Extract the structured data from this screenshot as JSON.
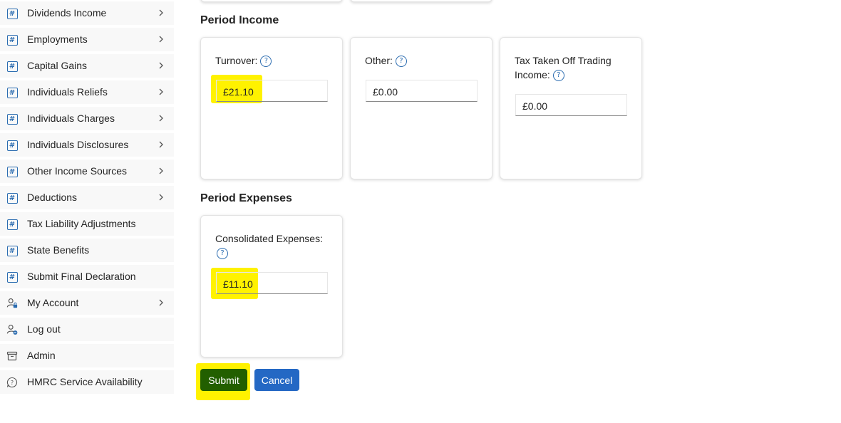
{
  "sidebar": {
    "items": [
      {
        "label": "Dividends Income",
        "icon": "hash-icon",
        "chevron": true
      },
      {
        "label": "Employments",
        "icon": "hash-icon",
        "chevron": true
      },
      {
        "label": "Capital Gains",
        "icon": "hash-icon",
        "chevron": true
      },
      {
        "label": "Individuals Reliefs",
        "icon": "hash-icon",
        "chevron": true
      },
      {
        "label": "Individuals Charges",
        "icon": "hash-icon",
        "chevron": true
      },
      {
        "label": "Individuals Disclosures",
        "icon": "hash-icon",
        "chevron": true
      },
      {
        "label": "Other Income Sources",
        "icon": "hash-icon",
        "chevron": true
      },
      {
        "label": "Deductions",
        "icon": "hash-icon",
        "chevron": true
      },
      {
        "label": "Tax Liability Adjustments",
        "icon": "hash-icon",
        "chevron": false
      },
      {
        "label": "State Benefits",
        "icon": "hash-icon",
        "chevron": false
      },
      {
        "label": "Submit Final Declaration",
        "icon": "hash-icon",
        "chevron": false
      },
      {
        "label": "My Account",
        "icon": "person-lock-icon",
        "chevron": true
      },
      {
        "label": "Log out",
        "icon": "person-minus-icon",
        "chevron": false
      },
      {
        "label": "Admin",
        "icon": "archive-icon",
        "chevron": false
      },
      {
        "label": "HMRC Service Availability",
        "icon": "chat-help-icon",
        "chevron": false
      }
    ]
  },
  "income": {
    "title": "Period Income",
    "turnover": {
      "label": "Turnover:",
      "value": "£21.10"
    },
    "other": {
      "label": "Other:",
      "value": "£0.00"
    },
    "tax_taken": {
      "label_line1": "Tax Taken Off Trading",
      "label_line2": "Income:",
      "value": "£0.00"
    }
  },
  "expenses": {
    "title": "Period Expenses",
    "consolidated": {
      "label": "Consolidated Expenses:",
      "value": "£11.10"
    }
  },
  "help_glyph": "?",
  "hash_glyph": "#",
  "buttons": {
    "submit": "Submit",
    "cancel": "Cancel"
  },
  "colors": {
    "accent": "#2b6cb0",
    "submit_bg": "#225f00",
    "cancel_bg": "#2468c4",
    "highlight": "#fff200"
  }
}
